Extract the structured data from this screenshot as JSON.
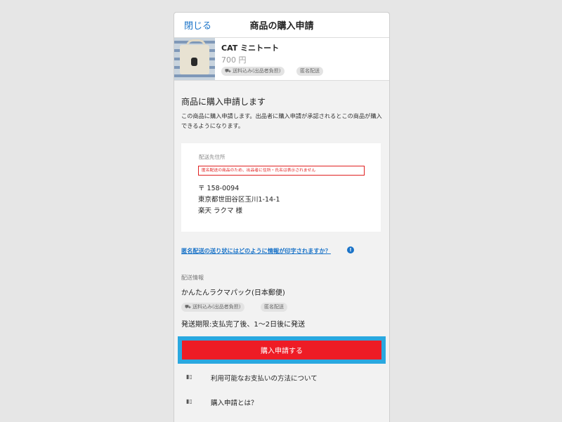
{
  "header": {
    "close_label": "閉じる",
    "title": "商品の購入申請"
  },
  "product": {
    "name": "CAT ミニトート",
    "price": "700 円",
    "tags": [
      "送料込み(出品者負担)",
      "匿名配送"
    ]
  },
  "request": {
    "title": "商品に購入申請します",
    "description": "この商品に購入申請します。出品者に購入申請が承認されるとこの商品が購入できるようになります。"
  },
  "address": {
    "label": "配送先住所",
    "warning": "匿名配送の商品のため、出品者に住所・氏名は表示されません",
    "postal": "〒 158-0094",
    "street": "東京都世田谷区玉川1-14-1",
    "name": "楽天 ラクマ 様"
  },
  "info_link": {
    "text": "匿名配送の送り状にはどのように情報が印字されますか？",
    "icon": "info-icon"
  },
  "shipping": {
    "label": "配送情報",
    "method": "かんたんラクマパック(日本郵便)",
    "tags": [
      "送料込み(出品者負担)",
      "匿名配送"
    ],
    "deadline": "発送期限:支払完了後、1〜2日後に発送"
  },
  "buy_button": {
    "label": "購入申請する"
  },
  "help_links": [
    {
      "text": "利用可能なお支払いの方法について",
      "icon": "book-icon"
    },
    {
      "text": "購入申請とは？",
      "icon": "book-icon"
    }
  ],
  "colors": {
    "accent_blue": "#1a73c8",
    "button_red": "#ee1c25",
    "highlight_border": "#2aa8e0",
    "warning_red": "#e02020"
  }
}
